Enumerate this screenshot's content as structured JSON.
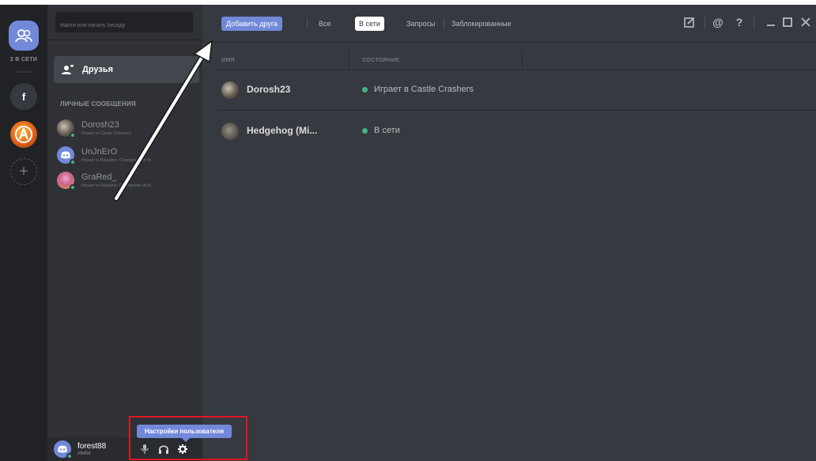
{
  "guilds": {
    "online_count": "2 В СЕТИ",
    "server_f_label": "f"
  },
  "sidebar": {
    "search_placeholder": "Найти или начать беседу",
    "friends_label": "Друзья",
    "dm_header": "ЛИЧНЫЕ СООБЩЕНИЯ",
    "dms": [
      {
        "name": "Dorosh23",
        "activity": "Играет в Castle Crashers"
      },
      {
        "name": "UnJnErO",
        "activity": "Играет в Paladins: Champions of th..."
      },
      {
        "name": "GraRed_",
        "activity": "Играет в Paladins: Champions of th..."
      }
    ]
  },
  "user_panel": {
    "username": "forest88",
    "discriminator": "#6456",
    "tooltip": "Настройки пользователя"
  },
  "header": {
    "add_friend": "Добавить друга",
    "tabs": [
      "Все",
      "В сети",
      "Запросы",
      "Заблокированные"
    ],
    "active_tab": "В сети"
  },
  "table": {
    "col_name": "ИМЯ",
    "col_status": "СОСТОЯНИЕ",
    "rows": [
      {
        "name": "Dorosh23",
        "status": "Играет в Castle Crashers"
      },
      {
        "name": "Hedgehog (Mi...",
        "status": "В сети"
      }
    ]
  },
  "colors": {
    "accent": "#7289da",
    "online": "#43b581",
    "highlight": "#e0141e",
    "background": "#36393f"
  },
  "icons": [
    "friends-icon",
    "new-group-dm-icon",
    "mention-icon",
    "help-icon",
    "minimize-icon",
    "maximize-icon",
    "close-icon",
    "microphone-icon",
    "headphones-icon",
    "settings-gear-icon"
  ]
}
